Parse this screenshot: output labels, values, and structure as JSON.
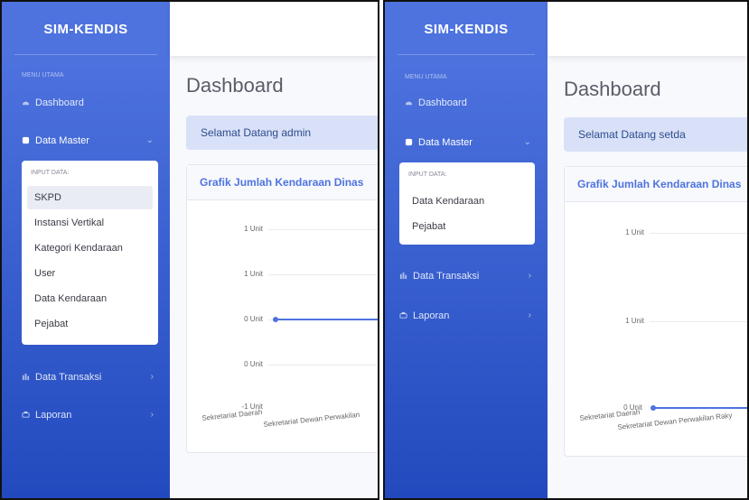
{
  "left": {
    "brand": "SIM-KENDIS",
    "menu_heading": "MENU UTAMA",
    "nav": {
      "dashboard": "Dashboard",
      "data_master": "Data Master",
      "data_transaksi": "Data Transaksi",
      "laporan": "Laporan"
    },
    "dropdown": {
      "heading": "INPUT DATA:",
      "items": [
        "SKPD",
        "Instansi Vertikal",
        "Kategori Kendaraan",
        "User",
        "Data Kendaraan",
        "Pejabat"
      ],
      "selected": "SKPD"
    },
    "page_title": "Dashboard",
    "welcome": "Selamat Datang admin",
    "card_title": "Grafik Jumlah Kendaraan Dinas",
    "chart_data": {
      "type": "line",
      "title": "",
      "y_tick_labels": [
        "1 Unit",
        "1 Unit",
        "0 Unit",
        "0 Unit",
        "-1 Unit"
      ],
      "x_tick_labels": [
        "Sekretariat Daerah",
        "Sekretariat Dewan Perwakilan"
      ],
      "series": [
        {
          "values": [
            0,
            0
          ]
        }
      ],
      "grid": true
    }
  },
  "right": {
    "brand": "SIM-KENDIS",
    "menu_heading": "MENU UTAMA",
    "nav": {
      "dashboard": "Dashboard",
      "data_master": "Data Master",
      "data_transaksi": "Data Transaksi",
      "laporan": "Laporan"
    },
    "dropdown": {
      "heading": "INPUT DATA:",
      "items": [
        "Data Kendaraan",
        "Pejabat"
      ]
    },
    "page_title": "Dashboard",
    "welcome": "Selamat Datang setda",
    "card_title": "Grafik Jumlah Kendaraan Dinas",
    "chart_data": {
      "type": "line",
      "title": "",
      "y_tick_labels": [
        "1 Unit",
        "1 Unit",
        "0 Unit"
      ],
      "x_tick_labels": [
        "Sekretariat Daerah",
        "Sekretariat Dewan Perwakilan Raky"
      ],
      "series": [
        {
          "values": [
            0,
            0
          ]
        }
      ],
      "grid": true
    }
  },
  "colors": {
    "sidebar_top": "#4e73df",
    "sidebar_bottom": "#224abe",
    "accent": "#4e73df",
    "text_dark": "#5a5c69",
    "alert_bg": "#d8e1f7"
  }
}
